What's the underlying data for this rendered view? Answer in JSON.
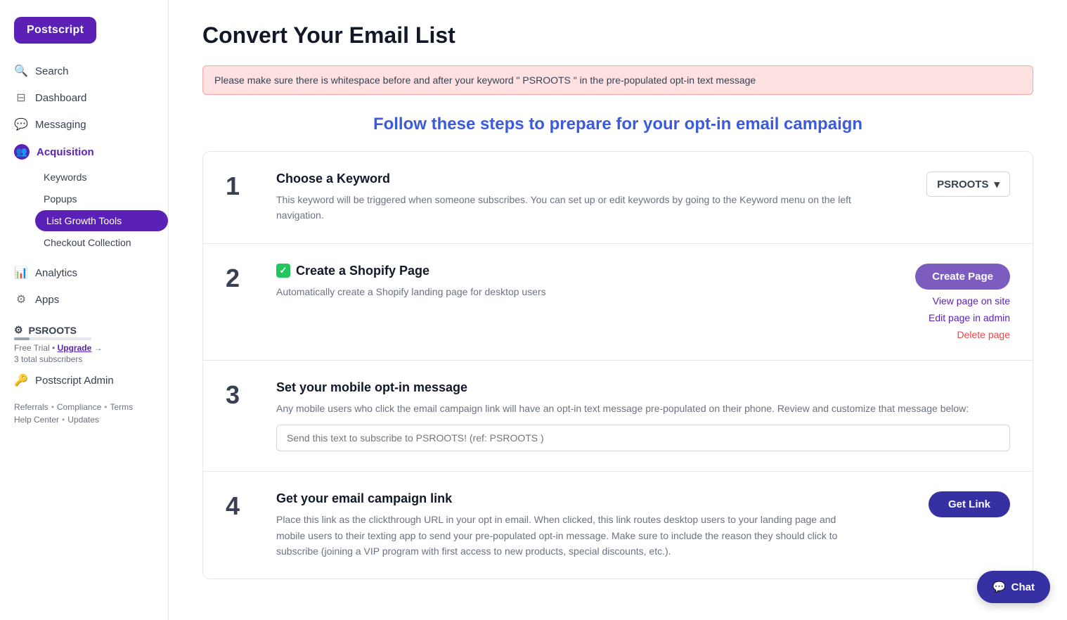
{
  "app": {
    "logo_label": "Postscript"
  },
  "sidebar": {
    "nav_items": [
      {
        "id": "search",
        "label": "Search",
        "icon": "🔍"
      },
      {
        "id": "dashboard",
        "label": "Dashboard",
        "icon": "⊟"
      },
      {
        "id": "messaging",
        "label": "Messaging",
        "icon": "💬"
      },
      {
        "id": "acquisition",
        "label": "Acquisition",
        "icon": "👥",
        "active": true
      }
    ],
    "acquisition_sub": [
      {
        "id": "keywords",
        "label": "Keywords"
      },
      {
        "id": "popups",
        "label": "Popups"
      },
      {
        "id": "list-growth-tools",
        "label": "List Growth Tools",
        "active": true
      },
      {
        "id": "checkout-collection",
        "label": "Checkout Collection"
      }
    ],
    "nav_items2": [
      {
        "id": "analytics",
        "label": "Analytics",
        "icon": "📊"
      },
      {
        "id": "apps",
        "label": "Apps",
        "icon": "⚙"
      }
    ],
    "store": {
      "name": "PSROOTS",
      "icon": "⚙",
      "trial_label": "Free Trial",
      "upgrade_label": "Upgrade",
      "arrow": "→",
      "subscribers": "3 total subscribers"
    },
    "admin_label": "Postscript Admin",
    "admin_icon": "🔑",
    "footer": {
      "referrals": "Referrals",
      "compliance": "Compliance",
      "terms": "Terms",
      "help_center": "Help Center",
      "updates": "Updates",
      "dot": "•"
    }
  },
  "main": {
    "page_title": "Convert Your Email List",
    "alert_text": "Please make sure there is whitespace before and after your keyword \" PSROOTS \" in the pre-populated opt-in text message",
    "steps_heading": "Follow these steps to prepare for your opt-in email campaign",
    "steps": [
      {
        "number": "1",
        "title": "Choose a Keyword",
        "description": "This keyword will be triggered when someone subscribes. You can set up or edit keywords by going to the Keyword menu on the left navigation.",
        "action_type": "dropdown",
        "dropdown_label": "PSROOTS",
        "dropdown_arrow": "▾",
        "has_check": false
      },
      {
        "number": "2",
        "title": "Create a Shopify Page",
        "description": "Automatically create a Shopify landing page for desktop users",
        "action_type": "buttons",
        "create_page_label": "Create Page",
        "view_page_label": "View page on site",
        "edit_page_label": "Edit page in admin",
        "delete_page_label": "Delete page",
        "has_check": true
      },
      {
        "number": "3",
        "title": "Set your mobile opt-in message",
        "description": "Any mobile users who click the email campaign link will have an opt-in text message pre-populated on their phone. Review and customize that message below:",
        "action_type": "input",
        "input_placeholder": "Send this text to subscribe to PSROOTS! (ref: PSROOTS )",
        "has_check": false
      },
      {
        "number": "4",
        "title": "Get your email campaign link",
        "description": "Place this link as the clickthrough URL in your opt in email. When clicked, this link routes desktop users to your landing page and mobile users to their texting app to send your pre-populated opt-in message. Make sure to include the reason they should click to subscribe (joining a VIP program with first access to new products, special discounts, etc.).",
        "action_type": "get-link",
        "get_link_label": "Get Link",
        "has_check": false
      }
    ],
    "chat": {
      "icon": "💬",
      "label": "Chat"
    }
  }
}
